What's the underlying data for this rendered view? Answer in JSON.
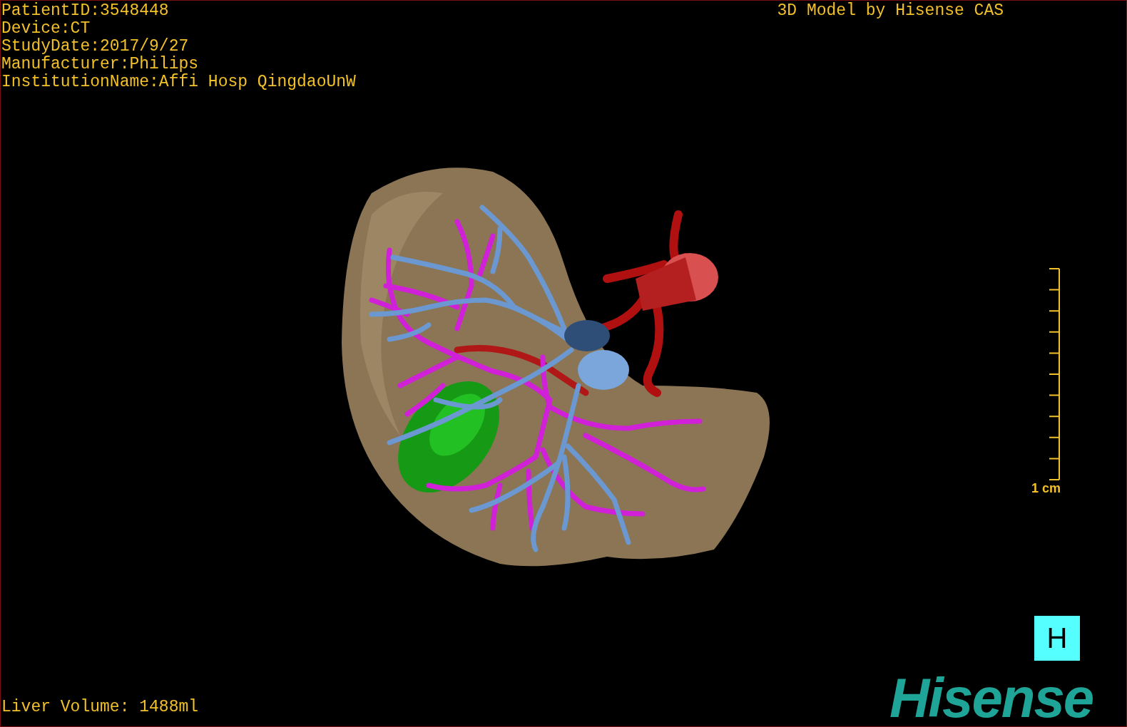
{
  "info_lines": [
    "PatientID:3548448",
    "Device:CT",
    "StudyDate:2017/9/27",
    "Manufacturer:Philips",
    "InstitutionName:Affi Hosp QingdaoUnW"
  ],
  "title": "3D Model by Hisense CAS",
  "scale_bar": {
    "label": "1 cm"
  },
  "view_button": {
    "label": "H"
  },
  "logo": "Hisense",
  "liver_volume": "Liver Volume: 1488ml"
}
